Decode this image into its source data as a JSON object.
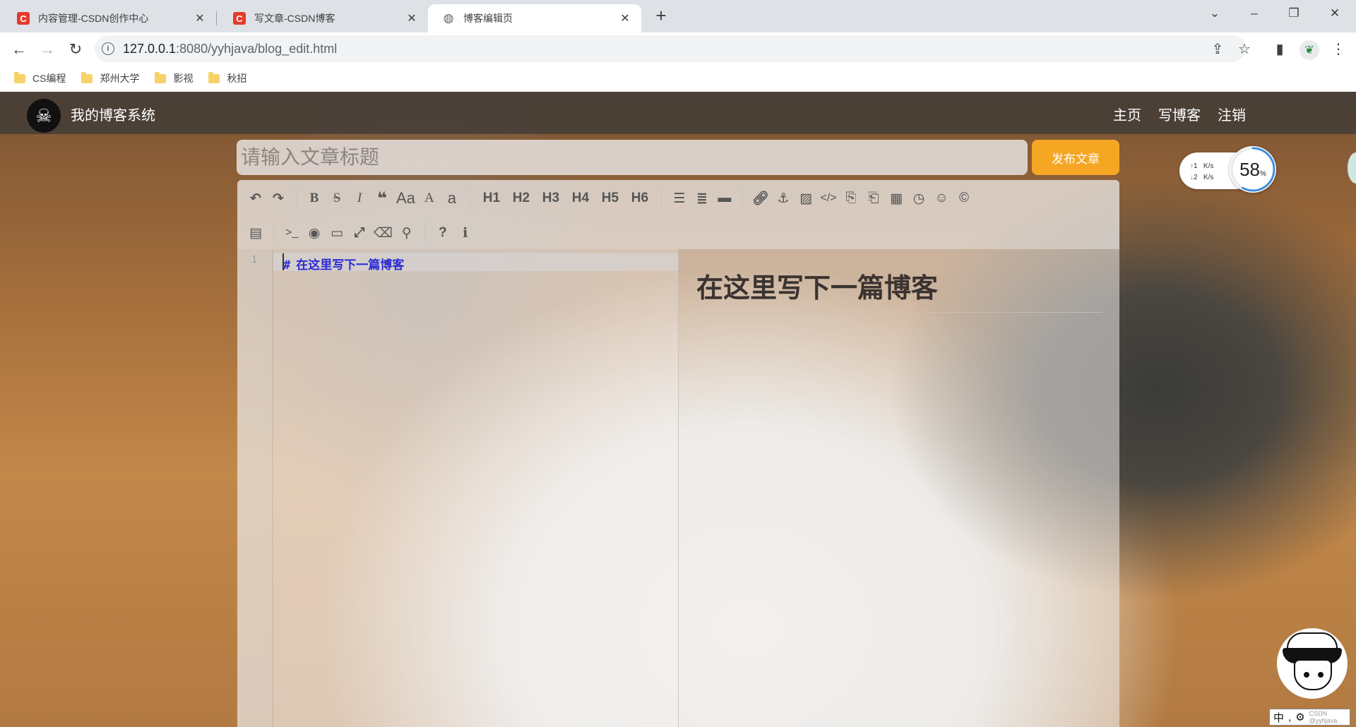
{
  "browser": {
    "tabs": [
      {
        "title": "内容管理-CSDN创作中心",
        "favicon": "csdn-icon",
        "active": false
      },
      {
        "title": "写文章-CSDN博客",
        "favicon": "csdn-icon",
        "active": false
      },
      {
        "title": "博客编辑页",
        "favicon": "globe-icon",
        "active": true
      }
    ],
    "url_host": "127.0.0.1",
    "url_rest": ":8080/yyhjava/blog_edit.html",
    "bookmarks": [
      "CS编程",
      "郑州大学",
      "影视",
      "秋招"
    ]
  },
  "site": {
    "name": "我的博客系统",
    "nav": [
      "主页",
      "写博客",
      "注销"
    ]
  },
  "editor": {
    "title_placeholder": "请输入文章标题",
    "publish_label": "发布文章",
    "heading_labels": [
      "H1",
      "H2",
      "H3",
      "H4",
      "H5",
      "H6"
    ],
    "line_number": "1",
    "markdown_hash": "#",
    "markdown_text": "在这里写下一篇博客",
    "preview_heading": "在这里写下一篇博客"
  },
  "netspeed": {
    "up_value": "1",
    "down_value": "2",
    "unit": "K/s",
    "gauge_value": "58",
    "gauge_percent": 58,
    "gauge_unit": "%"
  },
  "ime": {
    "mode": "中",
    "watermark": "CSDN @yyhjava"
  },
  "colors": {
    "publish_button": "#f5a623",
    "markdown_heading": "#2b2bd6",
    "csdn_red": "#e33b2e"
  }
}
